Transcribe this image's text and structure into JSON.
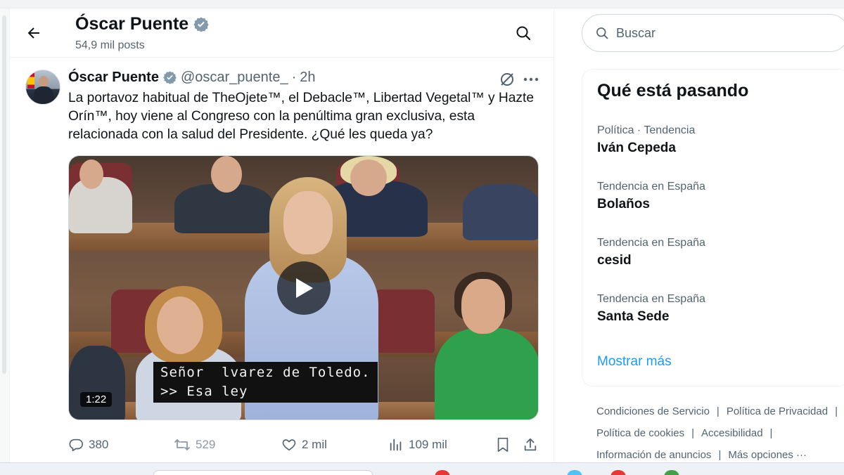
{
  "profile_header": {
    "name": "Óscar Puente",
    "post_count": "54,9 mil posts"
  },
  "tweet": {
    "author_name": "Óscar Puente",
    "handle": "@oscar_puente_",
    "separator": "·",
    "time": "2h",
    "text": "La portavoz habitual de TheOjete™, el Debacle™, Libertad Vegetal™ y Hazte Orín™, hoy viene al Congreso con la penúltima gran exclusiva, esta relacionada con la salud del Presidente. ¿Qué les queda ya?",
    "video": {
      "caption_line1": "Señor  lvarez de Toledo.",
      "caption_line2": ">> Esa ley",
      "duration": "1:22"
    },
    "stats": {
      "replies": "380",
      "reposts": "529",
      "likes": "2 mil",
      "views": "109 mil"
    }
  },
  "search": {
    "placeholder": "Buscar"
  },
  "trends": {
    "title": "Qué está pasando",
    "items": [
      {
        "meta": "Política · Tendencia",
        "topic": "Iván Cepeda"
      },
      {
        "meta": "Tendencia en España",
        "topic": "Bolaños"
      },
      {
        "meta": "Tendencia en España",
        "topic": "cesid"
      },
      {
        "meta": "Tendencia en España",
        "topic": "Santa Sede"
      }
    ],
    "show_more": "Mostrar más"
  },
  "footer": {
    "links": [
      "Condiciones de Servicio",
      "Política de Privacidad",
      "Política de cookies",
      "Accesibilidad",
      "Información de anuncios",
      "Más opciones ···"
    ],
    "separator": "|"
  },
  "colors": {
    "accent": "#1d9bf0",
    "verified_badge": "#829aab",
    "muted_text": "#536471"
  },
  "icons": [
    "back-arrow-icon",
    "verified-badge-icon",
    "search-icon",
    "grok-icon",
    "more-icon",
    "play-icon",
    "reply-icon",
    "repost-icon",
    "like-icon",
    "views-icon",
    "bookmark-icon",
    "share-icon"
  ]
}
